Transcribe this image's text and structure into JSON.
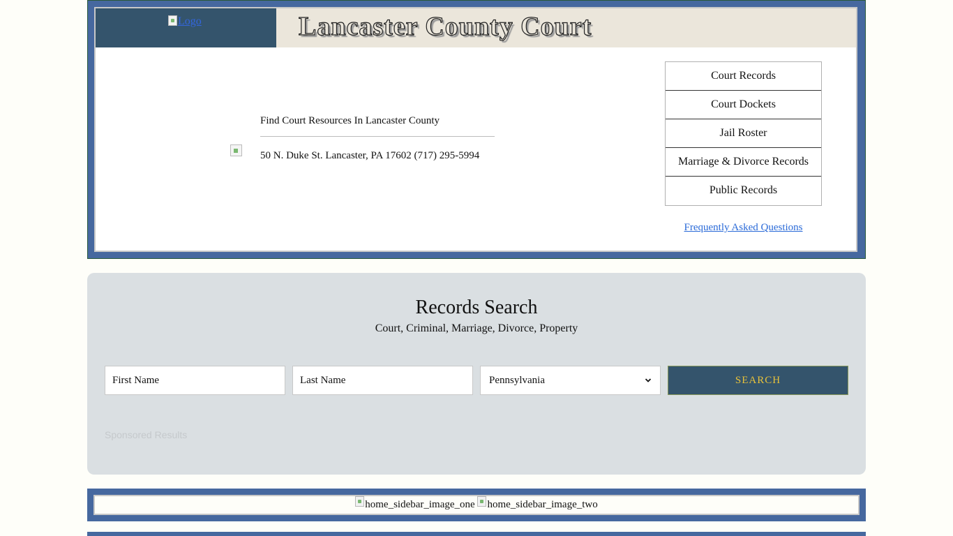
{
  "header": {
    "logo_alt": "Logo",
    "title": "Lancaster County Court"
  },
  "intro": {
    "tagline": "Find Court Resources In Lancaster County",
    "address": "50 N. Duke St. Lancaster, PA 17602 (717) 295-5994"
  },
  "nav": {
    "items": [
      {
        "label": "Court Records"
      },
      {
        "label": "Court Dockets"
      },
      {
        "label": "Jail Roster"
      },
      {
        "label": "Marriage & Divorce Records"
      },
      {
        "label": "Public Records"
      }
    ],
    "faq_label": "Frequently Asked Questions"
  },
  "search": {
    "title": "Records Search",
    "subtitle": "Court, Criminal, Marriage, Divorce, Property",
    "first_name_placeholder": "First Name",
    "last_name_placeholder": "Last Name",
    "state_selected": "Pennsylvania",
    "button_label": "SEARCH",
    "sponsored_label": "Sponsored Results"
  },
  "sidebar_images": {
    "image_one_alt": "home_sidebar_image_one",
    "image_two_alt": "home_sidebar_image_two"
  },
  "colors": {
    "frame_blue": "#46689f",
    "logo_bg": "#34546c",
    "title_bg": "#ebe6db",
    "search_bg": "#dadfe2",
    "button_text": "#e8c23a",
    "link": "#2a6ad8"
  }
}
